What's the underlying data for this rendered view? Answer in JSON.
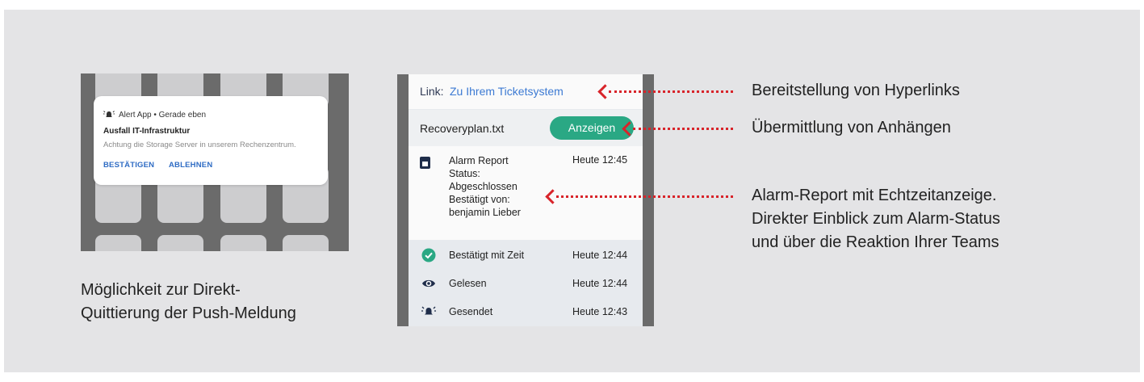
{
  "notification": {
    "app_line": "Alert App • Gerade eben",
    "title": "Ausfall IT-Infrastruktur",
    "message": "Achtung die Storage Server in unserem Rechenzentrum.",
    "confirm_label": "BESTÄTIGEN",
    "decline_label": "ABLEHNEN",
    "caption_line1": "Möglichkeit zur Direkt-",
    "caption_line2": "Quittierung der Push-Meldung"
  },
  "app": {
    "link_label": "Link:",
    "link_text": "Zu Ihrem Ticketsystem",
    "attachment_name": "Recoveryplan.txt",
    "show_button": "Anzeigen",
    "report": {
      "lines": [
        "Alarm Report",
        "Status:",
        "Abgeschlossen",
        "Bestätigt von:",
        "benjamin Lieber"
      ],
      "time": "Heute 12:45"
    },
    "status_rows": [
      {
        "label": "Bestätigt mit Zeit",
        "time": "Heute 12:44",
        "icon": "check-circle-icon"
      },
      {
        "label": "Gelesen",
        "time": "Heute 12:44",
        "icon": "eye-icon"
      },
      {
        "label": "Gesendet",
        "time": "Heute 12:43",
        "icon": "alarm-bell-icon"
      }
    ]
  },
  "annotations": {
    "hyperlinks": "Bereitstellung von Hyperlinks",
    "attachments": "Übermittlung von Anhängen",
    "report_line1": "Alarm-Report mit Echtzeitanzeige.",
    "report_line2": "Direkter Einblick zum Alarm-Status",
    "report_line3": "und über die Reaktion Ihrer Teams"
  },
  "colors": {
    "accent_green": "#2aa884",
    "link_blue": "#3c7ad3",
    "annotation_red": "#d8242a",
    "background": "#e4e4e6"
  }
}
